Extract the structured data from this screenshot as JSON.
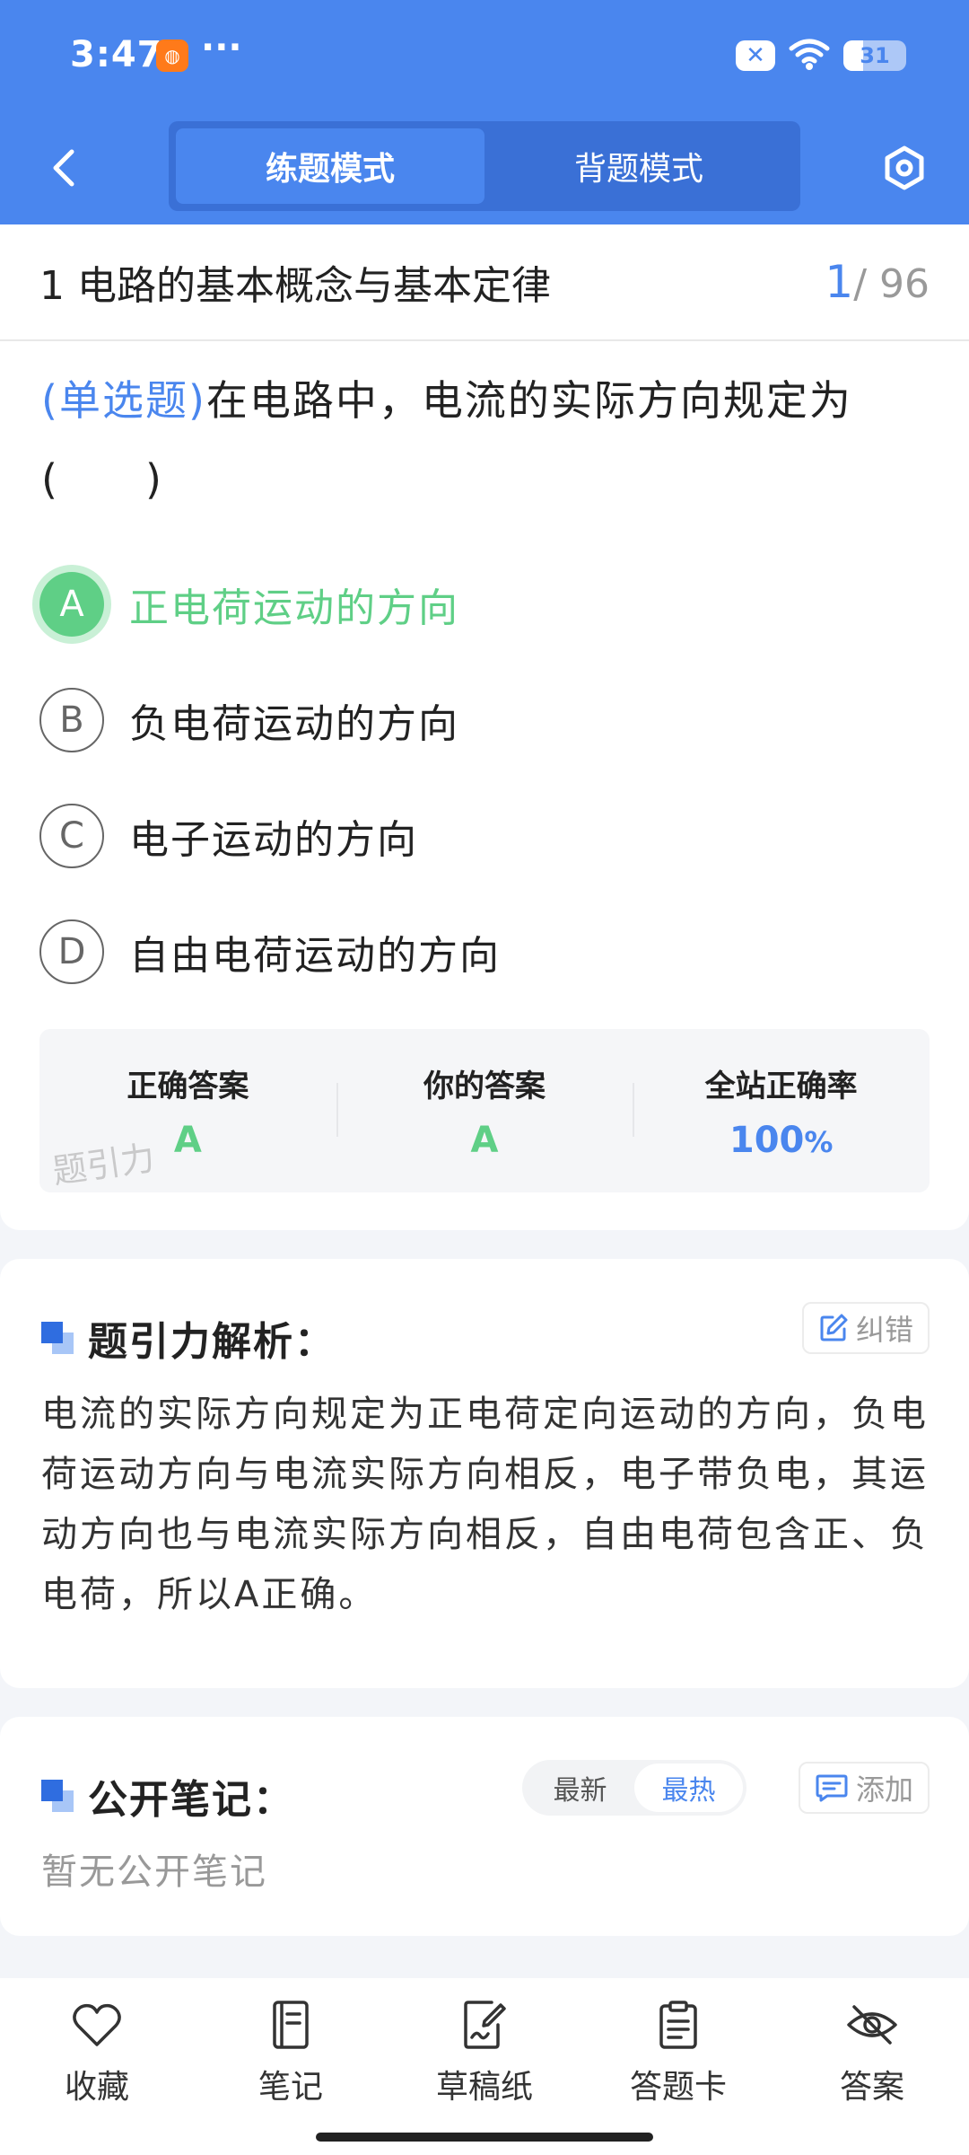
{
  "status_bar": {
    "time": "3:47",
    "dots": "···",
    "x_badge": "✕",
    "battery": "31",
    "battery_level": 0.31
  },
  "header": {
    "modes": [
      {
        "label": "练题模式",
        "active": true
      },
      {
        "label": "背题模式",
        "active": false
      }
    ]
  },
  "chapter": {
    "title": "1 电路的基本概念与基本定律",
    "current": "1",
    "total": "/ 96"
  },
  "question": {
    "type": "(单选题)",
    "text": "在电路中，电流的实际方向规定为(　　)",
    "options": [
      {
        "letter": "A",
        "text": "正电荷运动的方向",
        "state": "correct"
      },
      {
        "letter": "B",
        "text": "负电荷运动的方向",
        "state": "normal"
      },
      {
        "letter": "C",
        "text": "电子运动的方向",
        "state": "normal"
      },
      {
        "letter": "D",
        "text": "自由电荷运动的方向",
        "state": "normal"
      }
    ]
  },
  "answers": {
    "correct_label": "正确答案",
    "correct_value": "A",
    "yours_label": "你的答案",
    "yours_value": "A",
    "rate_label": "全站正确率",
    "rate_value": "100",
    "rate_unit": "%",
    "watermark": "题引力"
  },
  "analysis": {
    "title": "题引力解析：",
    "correction_label": "纠错",
    "text": "电流的实际方向规定为正电荷定向运动的方向，负电荷运动方向与电流实际方向相反，电子带负电，其运动方向也与电流实际方向相反，自由电荷包含正、负电荷，所以A正确。"
  },
  "notes": {
    "title": "公开笔记：",
    "sort_options": [
      "最新",
      "最热"
    ],
    "sort_active": "最热",
    "add_label": "添加",
    "empty_text": "暂无公开笔记"
  },
  "bottom_nav": [
    {
      "label": "收藏",
      "icon": "heart-icon"
    },
    {
      "label": "笔记",
      "icon": "notebook-icon"
    },
    {
      "label": "草稿纸",
      "icon": "draft-paper-icon"
    },
    {
      "label": "答题卡",
      "icon": "answer-card-icon"
    },
    {
      "label": "答案",
      "icon": "eye-off-icon"
    }
  ],
  "colors": {
    "primary": "#4a86ee",
    "correct": "#5fcf86",
    "background": "#f3f5f9"
  }
}
